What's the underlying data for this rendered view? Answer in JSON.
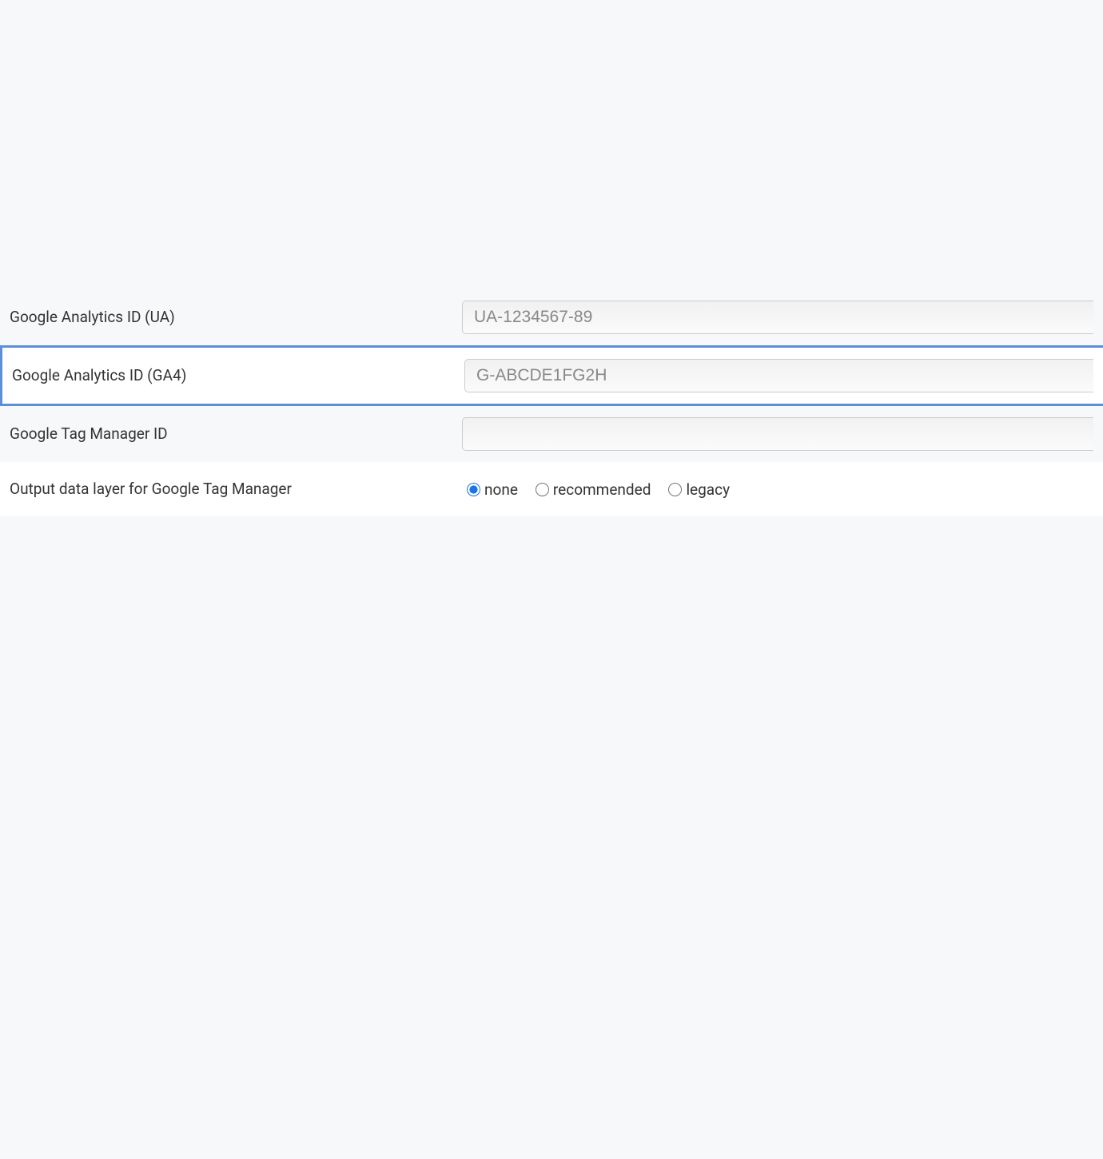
{
  "fields": {
    "ua": {
      "label": "Google Analytics ID (UA)",
      "placeholder": "UA-1234567-89",
      "value": ""
    },
    "ga4": {
      "label": "Google Analytics ID (GA4)",
      "placeholder": "G-ABCDE1FG2H",
      "value": ""
    },
    "gtm": {
      "label": "Google Tag Manager ID",
      "placeholder": "",
      "value": ""
    },
    "dataLayer": {
      "label": "Output data layer for Google Tag Manager",
      "options": {
        "none": "none",
        "recommended": "recommended",
        "legacy": "legacy"
      },
      "selected": "none"
    }
  }
}
